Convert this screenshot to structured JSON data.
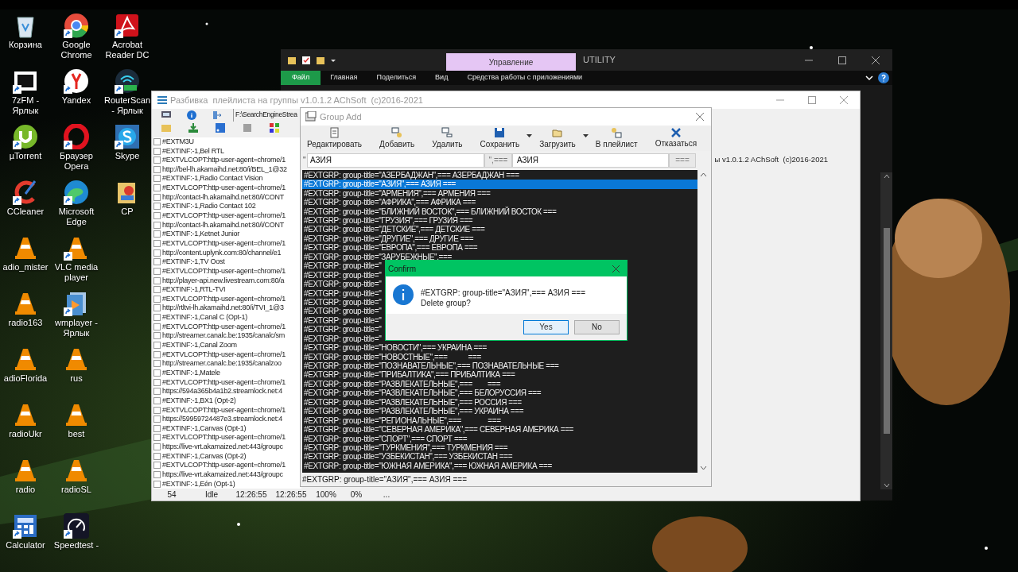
{
  "desktop_icons": [
    {
      "label": "Корзина",
      "kind": "recycle",
      "shortcut": false
    },
    {
      "label": "7zFM - Ярлык",
      "kind": "sevenzip",
      "shortcut": true
    },
    {
      "label": "µTorrent",
      "kind": "utorrent",
      "shortcut": true
    },
    {
      "label": "CCleaner",
      "kind": "ccleaner",
      "shortcut": true
    },
    {
      "label": "adio_mister",
      "kind": "vlc",
      "shortcut": false
    },
    {
      "label": "radio163",
      "kind": "vlc",
      "shortcut": false
    },
    {
      "label": "adioFlorida",
      "kind": "vlc",
      "shortcut": false
    },
    {
      "label": "radioUkr",
      "kind": "vlc",
      "shortcut": false
    },
    {
      "label": "radio",
      "kind": "vlc",
      "shortcut": false
    },
    {
      "label": "Calculator",
      "kind": "calculator",
      "shortcut": true
    },
    {
      "label": "Google Chrome",
      "kind": "chrome",
      "shortcut": true
    },
    {
      "label": "Yandex",
      "kind": "yandex",
      "shortcut": true
    },
    {
      "label": "Браузер Opera",
      "kind": "opera",
      "shortcut": true
    },
    {
      "label": "Microsoft Edge",
      "kind": "edge",
      "shortcut": true
    },
    {
      "label": "VLC media player",
      "kind": "vlc",
      "shortcut": true
    },
    {
      "label": "wmplayer - Ярлык",
      "kind": "wmplayer",
      "shortcut": true
    },
    {
      "label": "rus",
      "kind": "vlc",
      "shortcut": false
    },
    {
      "label": "best",
      "kind": "vlc",
      "shortcut": false
    },
    {
      "label": "radioSL",
      "kind": "vlc",
      "shortcut": false
    },
    {
      "label": "Speedtest -",
      "kind": "speedtest",
      "shortcut": true
    },
    {
      "label": "Acrobat Reader DC",
      "kind": "acrobat",
      "shortcut": true
    },
    {
      "label": "RouterScan - Ярлык",
      "kind": "routerscan",
      "shortcut": true
    },
    {
      "label": "Skype",
      "kind": "skype",
      "shortcut": true
    },
    {
      "label": "CP",
      "kind": "cp",
      "shortcut": false
    }
  ],
  "explorer": {
    "context_tab": "Управление",
    "title": "UTILITY",
    "ribbon_tabs": [
      {
        "label": "Файл",
        "selected": true
      },
      {
        "label": "Главная",
        "selected": false
      },
      {
        "label": "Поделиться",
        "selected": false
      },
      {
        "label": "Вид",
        "selected": false
      },
      {
        "label": "Средства работы с приложениями",
        "selected": false
      }
    ]
  },
  "main_window": {
    "title": "Разбивка  плейлиста на группы v1.0.1.2 AChSoft  (c)2016-2021",
    "path": "F:\\SearchEngineStrea",
    "items": [
      {
        "text": "#EXTM3U",
        "checked": false
      },
      {
        "text": "#EXTINF:-1,Bel RTL",
        "checked": false
      },
      {
        "text": "#EXTVLCOPT:http-user-agent=chrome/1",
        "checked": false
      },
      {
        "text": "http://bel-lh.akamaihd.net:80/i/BEL_1@32",
        "checked": false
      },
      {
        "text": "#EXTINF:-1,Radio Contact Vision",
        "checked": false
      },
      {
        "text": "#EXTVLCOPT:http-user-agent=chrome/1",
        "checked": false
      },
      {
        "text": "http://contact-lh.akamaihd.net:80/i/CONT",
        "checked": false
      },
      {
        "text": "#EXTINF:-1,Radio Contact 102",
        "checked": false
      },
      {
        "text": "#EXTVLCOPT:http-user-agent=chrome/1",
        "checked": false
      },
      {
        "text": "http://contact-lh.akamaihd.net:80/i/CONT",
        "checked": false
      },
      {
        "text": "#EXTINF:-1,Ketnet Junior",
        "checked": false
      },
      {
        "text": "#EXTVLCOPT:http-user-agent=chrome/1",
        "checked": false
      },
      {
        "text": "http://content.uplynk.com:80/channel/e1",
        "checked": false
      },
      {
        "text": "#EXTINF:-1,TV Oost",
        "checked": false
      },
      {
        "text": "#EXTVLCOPT:http-user-agent=chrome/1",
        "checked": false
      },
      {
        "text": "http://player-api.new.livestream.com:80/a",
        "checked": false
      },
      {
        "text": "#EXTINF:-1,RTL-TVI",
        "checked": false
      },
      {
        "text": "#EXTVLCOPT:http-user-agent=chrome/1",
        "checked": false
      },
      {
        "text": "http://rtltvi-lh.akamaihd.net:80/i/TVI_1@3",
        "checked": false
      },
      {
        "text": "#EXTINF:-1,Canal C (Opt-1)",
        "checked": false
      },
      {
        "text": "#EXTVLCOPT:http-user-agent=chrome/1",
        "checked": false
      },
      {
        "text": "http://streamer.canalc.be:1935/canalc/sm",
        "checked": false
      },
      {
        "text": "#EXTINF:-1,Canal Zoom",
        "checked": false
      },
      {
        "text": "#EXTVLCOPT:http-user-agent=chrome/1",
        "checked": false
      },
      {
        "text": "http://streamer.canalc.be:1935/canalzoo",
        "checked": false
      },
      {
        "text": "#EXTINF:-1,Matele",
        "checked": false
      },
      {
        "text": "#EXTVLCOPT:http-user-agent=chrome/1",
        "checked": false
      },
      {
        "text": "https://594a365b4a1b2.streamlock.net:4",
        "checked": false
      },
      {
        "text": "#EXTINF:-1,BX1 (Opt-2)",
        "checked": false
      },
      {
        "text": "#EXTVLCOPT:http-user-agent=chrome/1",
        "checked": false
      },
      {
        "text": "https://59959724487e3.streamlock.net:4",
        "checked": false
      },
      {
        "text": "#EXTINF:-1,Canvas (Opt-1)",
        "checked": false
      },
      {
        "text": "#EXTVLCOPT:http-user-agent=chrome/1",
        "checked": false
      },
      {
        "text": "https://live-vrt.akamaized.net:443/groupc",
        "checked": false
      },
      {
        "text": "#EXTINF:-1,Canvas (Opt-2)",
        "checked": false
      },
      {
        "text": "#EXTVLCOPT:http-user-agent=chrome/1",
        "checked": false
      },
      {
        "text": "https://live-vrt.akamaized.net:443/groupc",
        "checked": false
      },
      {
        "text": "#EXTINF:-1,Eén (Opt-1)",
        "checked": false
      }
    ],
    "side_text": "ы v1.0.1.2 AChSoft  (c)2016-2021",
    "status": [
      "54",
      "Idle",
      "12:26:55",
      "12:26:55",
      "100%",
      "0%",
      "..."
    ]
  },
  "group_add": {
    "title": "Group Add",
    "toolbar": [
      {
        "label": "Редактировать",
        "kind": "edit",
        "dropdown": false
      },
      {
        "label": "Добавить",
        "kind": "add",
        "dropdown": false
      },
      {
        "label": "Удалить",
        "kind": "delete",
        "dropdown": false
      },
      {
        "label": "Сохранить",
        "kind": "save",
        "dropdown": true
      },
      {
        "label": "Загрузить",
        "kind": "load",
        "dropdown": true
      },
      {
        "label": "В плейлист",
        "kind": "playlist",
        "dropdown": false
      },
      {
        "label": "Отказаться",
        "kind": "cancel",
        "dropdown": false
      }
    ],
    "prefix": "\"",
    "name_value": "АЗИЯ",
    "separator": "\",===",
    "title_value": "АЗИЯ",
    "suffix": "===",
    "groups": [
      {
        "text": "#EXTGRP: group-title=\"АЗЕРБАДЖАН\",=== АЗЕРБАДЖАН ===",
        "selected": false
      },
      {
        "text": "#EXTGRP: group-title=\"АЗИЯ\",=== АЗИЯ ===",
        "selected": true
      },
      {
        "text": "#EXTGRP: group-title=\"АРМЕНИЯ\",=== АРМЕНИЯ ===",
        "selected": false
      },
      {
        "text": "#EXTGRP: group-title=\"АФРИКА\",=== АФРИКА ===",
        "selected": false
      },
      {
        "text": "#EXTGRP: group-title=\"БЛИЖНИЙ ВОСТОК\",=== БЛИЖНИЙ ВОСТОК ===",
        "selected": false
      },
      {
        "text": "#EXTGRP: group-title=\"ГРУЗИЯ\",=== ГРУЗИЯ ===",
        "selected": false
      },
      {
        "text": "#EXTGRP: group-title=\"ДЕТСКИЕ\",=== ДЕТСКИЕ ===",
        "selected": false
      },
      {
        "text": "#EXTGRP: group-title=\"ДРУГИЕ\",=== ДРУГИЕ ===",
        "selected": false
      },
      {
        "text": "#EXTGRP: group-title=\"ЕВРОПА\",=== ЕВРОПА ===",
        "selected": false
      },
      {
        "text": "#EXTGRP: group-title=\"ЗАРУБЕЖНЫЕ\",===",
        "selected": false
      },
      {
        "text": "#EXTGRP: group-title=\"",
        "selected": false
      },
      {
        "text": "#EXTGRP: group-title=\"",
        "selected": false
      },
      {
        "text": "#EXTGRP: group-title=\"",
        "selected": false
      },
      {
        "text": "#EXTGRP: group-title=\"",
        "selected": false
      },
      {
        "text": "#EXTGRP: group-title=\"",
        "selected": false
      },
      {
        "text": "#EXTGRP: group-title=\"",
        "selected": false
      },
      {
        "text": "#EXTGRP: group-title=\"",
        "selected": false
      },
      {
        "text": "#EXTGRP: group-title=\"",
        "selected": false
      },
      {
        "text": "#EXTGRP: group-title=\"",
        "selected": false
      },
      {
        "text": "#EXTGRP: group-title=\"НОВОСТИ\",=== УКРАИНА ===",
        "selected": false
      },
      {
        "text": "#EXTGRP: group-title=\"НОВОСТНЫЕ\",===           ===",
        "selected": false
      },
      {
        "text": "#EXTGRP: group-title=\"ПОЗНАВАТЕЛЬНЫЕ\",=== ПОЗНАВАТЕЛЬНЫЕ ===",
        "selected": false
      },
      {
        "text": "#EXTGRP: group-title=\"ПРИБАЛТИКА\",=== ПРИБАЛТИКА ===",
        "selected": false
      },
      {
        "text": "#EXTGRP: group-title=\"РАЗВЛЕКАТЕЛЬНЫЕ\",===        ===",
        "selected": false
      },
      {
        "text": "#EXTGRP: group-title=\"РАЗВЛЕКАТЕЛЬНЫЕ\",=== БЕЛОРУССИЯ ===",
        "selected": false
      },
      {
        "text": "#EXTGRP: group-title=\"РАЗВЛЕКАТЕЛЬНЫЕ\",=== РОССИЯ ===",
        "selected": false
      },
      {
        "text": "#EXTGRP: group-title=\"РАЗВЛЕКАТЕЛЬНЫЕ\",=== УКРАИНА ===",
        "selected": false
      },
      {
        "text": "#EXTGRP: group-title=\"РЕГИОНАЛЬНЫЕ\",===              ===",
        "selected": false
      },
      {
        "text": "#EXTGRP: group-title=\"СЕВЕРНАЯ АМЕРИКА\",=== СЕВЕРНАЯ АМЕРИКА ===",
        "selected": false
      },
      {
        "text": "#EXTGRP: group-title=\"СПОРТ\",=== СПОРТ ===",
        "selected": false
      },
      {
        "text": "#EXTGRP: group-title=\"ТУРКМЕНИЯ\",=== ТУРКМЕНИЯ ===",
        "selected": false
      },
      {
        "text": "#EXTGRP: group-title=\"УЗБЕКИСТАН\",=== УЗБЕКИСТАН ===",
        "selected": false
      },
      {
        "text": "#EXTGRP: group-title=\"ЮЖНАЯ АМЕРИКА\",=== ЮЖНАЯ АМЕРИКА ===",
        "selected": false
      }
    ],
    "current": "#EXTGRP: group-title=\"АЗИЯ\",=== АЗИЯ ==="
  },
  "confirm": {
    "title": "Confirm",
    "message": "#EXTGRP: group-title=\"АЗИЯ\",=== АЗИЯ ===",
    "question": "Delete group?",
    "buttons": [
      {
        "label": "Yes",
        "kind": "default"
      },
      {
        "label": "No",
        "kind": "normal"
      }
    ]
  }
}
